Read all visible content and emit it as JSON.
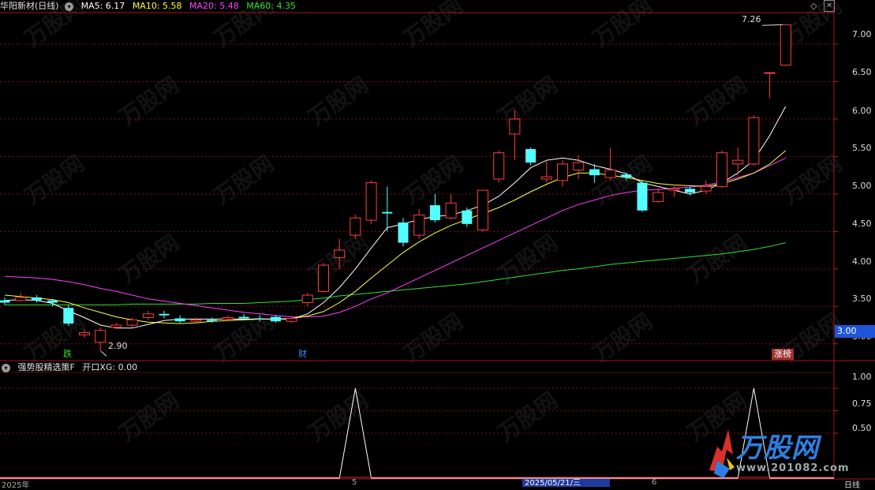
{
  "header": {
    "title": "华阳新材(日线)",
    "indicators": [
      {
        "label": "MA5: 6.17",
        "color": "#ffffff"
      },
      {
        "label": "MA10: 5.58",
        "color": "#ffff3c"
      },
      {
        "label": "MA20: 5.48",
        "color": "#ff40ff"
      },
      {
        "label": "MA60: 4.35",
        "color": "#30e030"
      }
    ]
  },
  "sub_header": {
    "title": "强势股精选策F",
    "value_label": "开口XG: 0.00"
  },
  "price_axis": {
    "ticks": [
      "7.00",
      "6.50",
      "6.00",
      "5.50",
      "5.00",
      "4.50",
      "4.00",
      "3.50",
      "3.00"
    ],
    "current_price": "3.00"
  },
  "sub_axis": {
    "ticks": [
      "1.00",
      "0.75",
      "0.50"
    ]
  },
  "annotations": {
    "high": "7.26",
    "low": "2.90",
    "badge_die": "跌",
    "badge_cai": "财",
    "badge_zhangbang": "涨榜"
  },
  "time_axis": {
    "left": "2025年",
    "mark1": "5",
    "cursor_date": "2025/05/21/三",
    "mark2": "6",
    "period": "日线"
  },
  "watermark": {
    "text": "万股网",
    "url": "www.201082.com"
  },
  "colors": {
    "up": "#ff3c3c",
    "down": "#54ffff",
    "ma5": "#ffffff",
    "ma10": "#ffff3c",
    "ma20": "#ff40ff",
    "ma60": "#30e030",
    "grid": "#7a1414"
  },
  "chart_data": {
    "type": "candlestick",
    "y_range": [
      2.85,
      7.4
    ],
    "candles": [
      {
        "o": 3.58,
        "c": 3.55,
        "h": 3.62,
        "l": 3.52
      },
      {
        "o": 3.58,
        "c": 3.62,
        "h": 3.68,
        "l": 3.56
      },
      {
        "o": 3.62,
        "c": 3.58,
        "h": 3.65,
        "l": 3.55
      },
      {
        "o": 3.58,
        "c": 3.55,
        "h": 3.6,
        "l": 3.5
      },
      {
        "o": 3.48,
        "c": 3.27,
        "h": 3.52,
        "l": 3.24
      },
      {
        "o": 3.12,
        "c": 3.15,
        "h": 3.2,
        "l": 3.08
      },
      {
        "o": 3.02,
        "c": 3.18,
        "h": 3.22,
        "l": 2.9
      },
      {
        "o": 3.22,
        "c": 3.25,
        "h": 3.28,
        "l": 3.2
      },
      {
        "o": 3.25,
        "c": 3.32,
        "h": 3.35,
        "l": 3.22
      },
      {
        "o": 3.35,
        "c": 3.4,
        "h": 3.44,
        "l": 3.32
      },
      {
        "o": 3.4,
        "c": 3.38,
        "h": 3.44,
        "l": 3.34
      },
      {
        "o": 3.34,
        "c": 3.3,
        "h": 3.38,
        "l": 3.28
      },
      {
        "o": 3.3,
        "c": 3.32,
        "h": 3.35,
        "l": 3.28
      },
      {
        "o": 3.32,
        "c": 3.3,
        "h": 3.35,
        "l": 3.28
      },
      {
        "o": 3.33,
        "c": 3.35,
        "h": 3.38,
        "l": 3.3
      },
      {
        "o": 3.36,
        "c": 3.34,
        "h": 3.4,
        "l": 3.32
      },
      {
        "o": 3.34,
        "c": 3.33,
        "h": 3.38,
        "l": 3.3
      },
      {
        "o": 3.36,
        "c": 3.3,
        "h": 3.38,
        "l": 3.28
      },
      {
        "o": 3.3,
        "c": 3.34,
        "h": 3.37,
        "l": 3.28
      },
      {
        "o": 3.55,
        "c": 3.65,
        "h": 3.68,
        "l": 3.5
      },
      {
        "o": 3.7,
        "c": 4.05,
        "h": 4.08,
        "l": 3.68
      },
      {
        "o": 4.15,
        "c": 4.25,
        "h": 4.4,
        "l": 4.0
      },
      {
        "o": 4.45,
        "c": 4.68,
        "h": 4.72,
        "l": 4.4
      },
      {
        "o": 4.65,
        "c": 5.15,
        "h": 5.18,
        "l": 4.6
      },
      {
        "o": 4.76,
        "c": 4.74,
        "h": 5.1,
        "l": 4.5
      },
      {
        "o": 4.62,
        "c": 4.35,
        "h": 4.68,
        "l": 4.3
      },
      {
        "o": 4.45,
        "c": 4.72,
        "h": 4.8,
        "l": 4.4
      },
      {
        "o": 4.85,
        "c": 4.65,
        "h": 5.0,
        "l": 4.62
      },
      {
        "o": 4.68,
        "c": 4.88,
        "h": 5.0,
        "l": 4.66
      },
      {
        "o": 4.78,
        "c": 4.6,
        "h": 4.82,
        "l": 4.56
      },
      {
        "o": 4.52,
        "c": 5.05,
        "h": 5.05,
        "l": 4.5
      },
      {
        "o": 5.2,
        "c": 5.55,
        "h": 5.58,
        "l": 5.15
      },
      {
        "o": 5.8,
        "c": 6.0,
        "h": 6.12,
        "l": 5.45
      },
      {
        "o": 5.6,
        "c": 5.42,
        "h": 5.62,
        "l": 5.38
      },
      {
        "o": 5.2,
        "c": 5.23,
        "h": 5.45,
        "l": 5.15
      },
      {
        "o": 5.18,
        "c": 5.4,
        "h": 5.45,
        "l": 5.1
      },
      {
        "o": 5.32,
        "c": 5.42,
        "h": 5.52,
        "l": 5.2
      },
      {
        "o": 5.33,
        "c": 5.25,
        "h": 5.4,
        "l": 5.15
      },
      {
        "o": 5.22,
        "c": 5.32,
        "h": 5.62,
        "l": 5.18
      },
      {
        "o": 5.26,
        "c": 5.22,
        "h": 5.28,
        "l": 5.18
      },
      {
        "o": 5.15,
        "c": 4.78,
        "h": 5.18,
        "l": 4.76
      },
      {
        "o": 4.9,
        "c": 5.02,
        "h": 5.08,
        "l": 4.88
      },
      {
        "o": 5.05,
        "c": 5.07,
        "h": 5.1,
        "l": 4.96
      },
      {
        "o": 5.07,
        "c": 5.02,
        "h": 5.1,
        "l": 4.98
      },
      {
        "o": 5.04,
        "c": 5.1,
        "h": 5.18,
        "l": 5.0
      },
      {
        "o": 5.1,
        "c": 5.55,
        "h": 5.58,
        "l": 5.08
      },
      {
        "o": 5.4,
        "c": 5.45,
        "h": 5.62,
        "l": 5.25
      },
      {
        "o": 5.4,
        "c": 6.02,
        "h": 6.05,
        "l": 5.38
      },
      {
        "o": 6.62,
        "c": 6.62,
        "h": 6.62,
        "l": 6.28
      },
      {
        "o": 6.72,
        "c": 7.26,
        "h": 7.26,
        "l": 6.72
      }
    ],
    "ma5": [
      3.58,
      3.59,
      3.58,
      3.54,
      3.44,
      3.35,
      3.25,
      3.21,
      3.21,
      3.26,
      3.31,
      3.33,
      3.33,
      3.33,
      3.33,
      3.33,
      3.33,
      3.33,
      3.33,
      3.4,
      3.55,
      3.75,
      4.0,
      4.28,
      4.55,
      4.6,
      4.66,
      4.7,
      4.72,
      4.78,
      4.85,
      4.97,
      5.15,
      5.35,
      5.45,
      5.48,
      5.45,
      5.38,
      5.33,
      5.27,
      5.15,
      5.1,
      5.05,
      5.0,
      5.05,
      5.15,
      5.28,
      5.45,
      5.78,
      6.17
    ],
    "ma10": [
      3.65,
      3.63,
      3.61,
      3.59,
      3.55,
      3.48,
      3.42,
      3.36,
      3.32,
      3.29,
      3.28,
      3.27,
      3.28,
      3.3,
      3.31,
      3.32,
      3.33,
      3.33,
      3.34,
      3.37,
      3.43,
      3.55,
      3.7,
      3.88,
      4.05,
      4.22,
      4.36,
      4.48,
      4.58,
      4.66,
      4.74,
      4.82,
      4.92,
      5.03,
      5.13,
      5.22,
      5.28,
      5.28,
      5.25,
      5.22,
      5.18,
      5.14,
      5.12,
      5.11,
      5.1,
      5.14,
      5.2,
      5.28,
      5.4,
      5.58
    ],
    "ma20": [
      3.9,
      3.89,
      3.88,
      3.86,
      3.83,
      3.79,
      3.74,
      3.7,
      3.65,
      3.6,
      3.57,
      3.54,
      3.51,
      3.48,
      3.45,
      3.42,
      3.4,
      3.38,
      3.36,
      3.36,
      3.37,
      3.42,
      3.5,
      3.6,
      3.68,
      3.78,
      3.88,
      3.98,
      4.08,
      4.18,
      4.28,
      4.38,
      4.48,
      4.58,
      4.68,
      4.78,
      4.86,
      4.92,
      4.98,
      5.02,
      5.05,
      5.06,
      5.08,
      5.09,
      5.12,
      5.16,
      5.22,
      5.28,
      5.38,
      5.48
    ],
    "ma60": [
      3.52,
      3.52,
      3.52,
      3.52,
      3.52,
      3.52,
      3.52,
      3.52,
      3.53,
      3.53,
      3.53,
      3.53,
      3.53,
      3.54,
      3.54,
      3.54,
      3.55,
      3.56,
      3.57,
      3.59,
      3.61,
      3.64,
      3.66,
      3.68,
      3.7,
      3.72,
      3.74,
      3.76,
      3.78,
      3.8,
      3.83,
      3.86,
      3.89,
      3.92,
      3.95,
      3.98,
      4.0,
      4.03,
      4.06,
      4.08,
      4.1,
      4.12,
      4.14,
      4.16,
      4.18,
      4.2,
      4.23,
      4.26,
      4.3,
      4.35
    ],
    "xg_signal": [
      0,
      0,
      0,
      0,
      0,
      0,
      0,
      0,
      0,
      0,
      0,
      0,
      0,
      0,
      0,
      0,
      0,
      0,
      0,
      0,
      0,
      0,
      1,
      0,
      0,
      0,
      0,
      0,
      0,
      0,
      0,
      0,
      0,
      0,
      0,
      0,
      0,
      0,
      0,
      0,
      0,
      0,
      0,
      0,
      0,
      0,
      0,
      1,
      0,
      0
    ],
    "sub_y_range": [
      0,
      1.15
    ]
  }
}
